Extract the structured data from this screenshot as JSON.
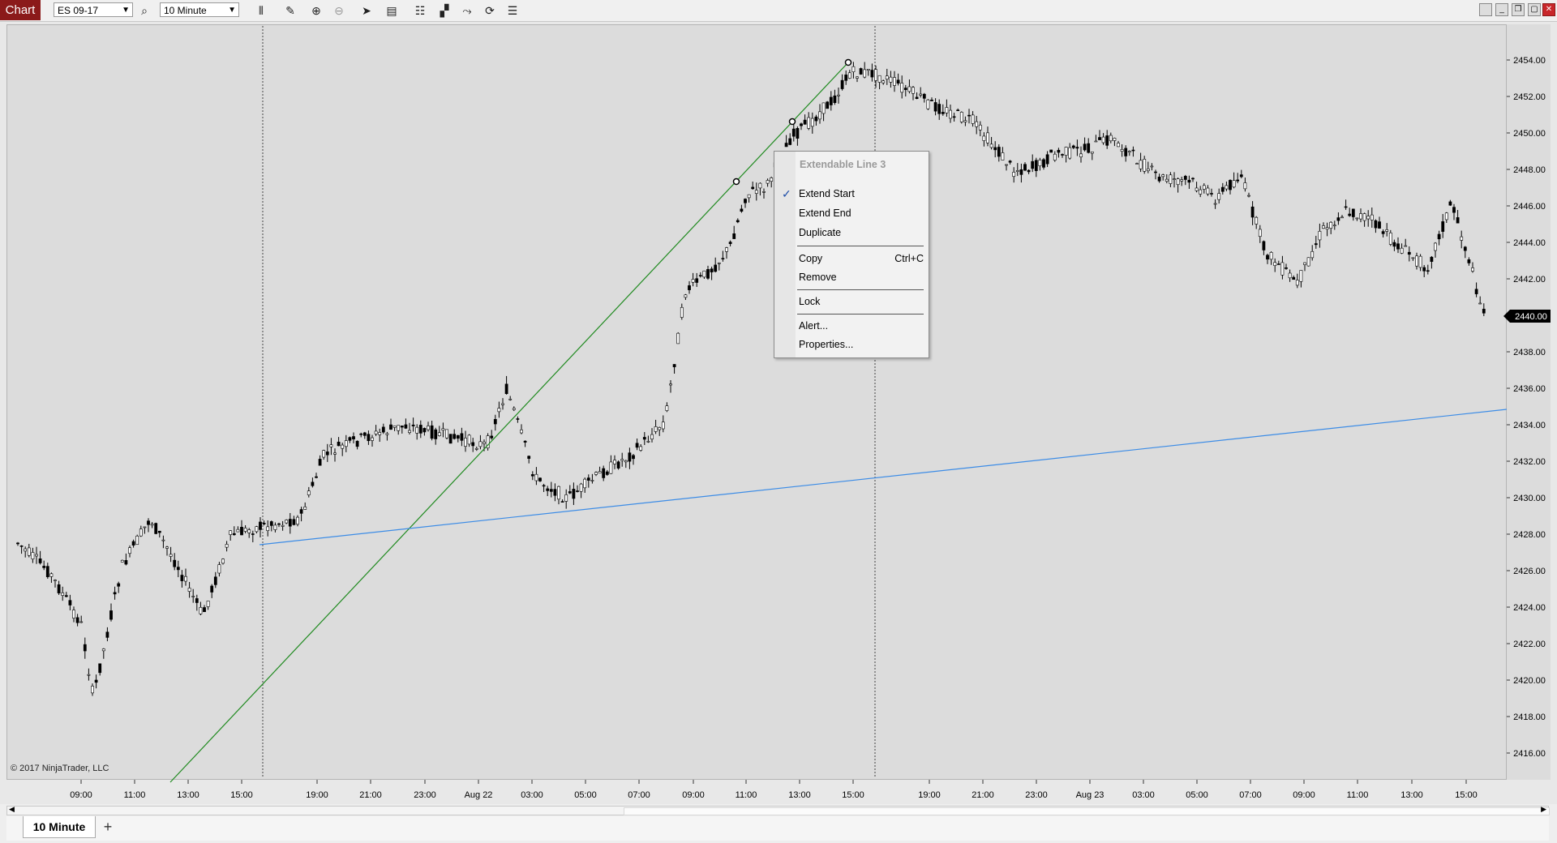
{
  "toolbar": {
    "title": "Chart",
    "instrument": "ES 09-17",
    "interval": "10 Minute",
    "icons": [
      "bars-icon",
      "pencil-icon",
      "zoom-in-icon",
      "zoom-out-icon",
      "pointer-icon",
      "data-box-icon",
      "properties-icon",
      "templates-icon",
      "strategies-icon",
      "indicators-icon",
      "share-icon",
      "list-icon"
    ]
  },
  "window_controls": [
    "minimize",
    "restore",
    "maximize",
    "close"
  ],
  "chart": {
    "y_axis": {
      "labels": [
        "2454.00",
        "2452.00",
        "2450.00",
        "2448.00",
        "2446.00",
        "2444.00",
        "2442.00",
        "2438.00",
        "2436.00",
        "2434.00",
        "2432.00",
        "2430.00",
        "2428.00",
        "2426.00",
        "2424.00",
        "2422.00",
        "2420.00",
        "2418.00",
        "2416.00"
      ],
      "current_price": "2440.00",
      "current_price_bg": "#000000"
    },
    "x_axis": {
      "labels": [
        "09:00",
        "11:00",
        "13:00",
        "15:00",
        "19:00",
        "21:00",
        "23:00",
        "Aug 22",
        "03:00",
        "05:00",
        "07:00",
        "09:00",
        "11:00",
        "13:00",
        "15:00",
        "19:00",
        "21:00",
        "23:00",
        "Aug 23",
        "03:00",
        "05:00",
        "07:00",
        "09:00",
        "11:00",
        "13:00",
        "15:00"
      ]
    },
    "copyright": "© 2017 NinjaTrader, LLC",
    "drawings": {
      "green_line_color": "#1f8a1f",
      "blue_line_color": "#3c8ce6"
    }
  },
  "context_menu": {
    "title": "Extendable Line 3",
    "items": [
      {
        "label": "Extend Start",
        "checked": true
      },
      {
        "label": "Extend End"
      },
      {
        "label": "Duplicate"
      },
      {
        "label": "Copy",
        "shortcut": "Ctrl+C"
      },
      {
        "label": "Remove"
      },
      {
        "label": "Lock"
      },
      {
        "label": "Alert..."
      },
      {
        "label": "Properties..."
      }
    ]
  },
  "tabs": {
    "active": "10 Minute",
    "add": "+"
  }
}
